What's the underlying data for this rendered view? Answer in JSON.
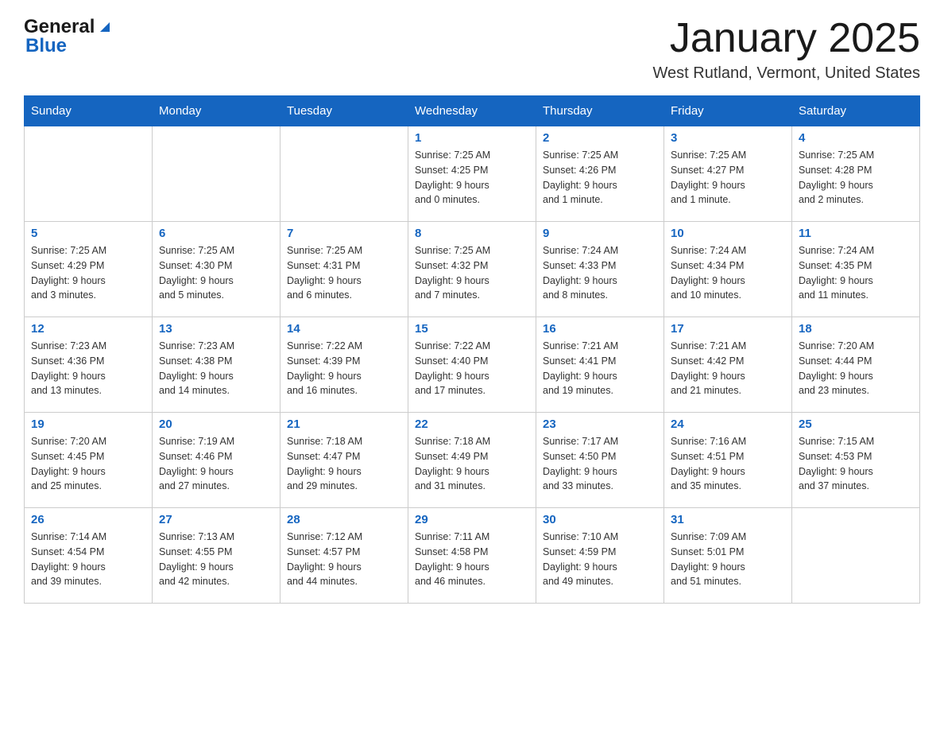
{
  "logo": {
    "general": "General",
    "arrow": "▲",
    "blue": "Blue"
  },
  "header": {
    "title": "January 2025",
    "subtitle": "West Rutland, Vermont, United States"
  },
  "days_of_week": [
    "Sunday",
    "Monday",
    "Tuesday",
    "Wednesday",
    "Thursday",
    "Friday",
    "Saturday"
  ],
  "weeks": [
    [
      {
        "day": "",
        "info": ""
      },
      {
        "day": "",
        "info": ""
      },
      {
        "day": "",
        "info": ""
      },
      {
        "day": "1",
        "info": "Sunrise: 7:25 AM\nSunset: 4:25 PM\nDaylight: 9 hours\nand 0 minutes."
      },
      {
        "day": "2",
        "info": "Sunrise: 7:25 AM\nSunset: 4:26 PM\nDaylight: 9 hours\nand 1 minute."
      },
      {
        "day": "3",
        "info": "Sunrise: 7:25 AM\nSunset: 4:27 PM\nDaylight: 9 hours\nand 1 minute."
      },
      {
        "day": "4",
        "info": "Sunrise: 7:25 AM\nSunset: 4:28 PM\nDaylight: 9 hours\nand 2 minutes."
      }
    ],
    [
      {
        "day": "5",
        "info": "Sunrise: 7:25 AM\nSunset: 4:29 PM\nDaylight: 9 hours\nand 3 minutes."
      },
      {
        "day": "6",
        "info": "Sunrise: 7:25 AM\nSunset: 4:30 PM\nDaylight: 9 hours\nand 5 minutes."
      },
      {
        "day": "7",
        "info": "Sunrise: 7:25 AM\nSunset: 4:31 PM\nDaylight: 9 hours\nand 6 minutes."
      },
      {
        "day": "8",
        "info": "Sunrise: 7:25 AM\nSunset: 4:32 PM\nDaylight: 9 hours\nand 7 minutes."
      },
      {
        "day": "9",
        "info": "Sunrise: 7:24 AM\nSunset: 4:33 PM\nDaylight: 9 hours\nand 8 minutes."
      },
      {
        "day": "10",
        "info": "Sunrise: 7:24 AM\nSunset: 4:34 PM\nDaylight: 9 hours\nand 10 minutes."
      },
      {
        "day": "11",
        "info": "Sunrise: 7:24 AM\nSunset: 4:35 PM\nDaylight: 9 hours\nand 11 minutes."
      }
    ],
    [
      {
        "day": "12",
        "info": "Sunrise: 7:23 AM\nSunset: 4:36 PM\nDaylight: 9 hours\nand 13 minutes."
      },
      {
        "day": "13",
        "info": "Sunrise: 7:23 AM\nSunset: 4:38 PM\nDaylight: 9 hours\nand 14 minutes."
      },
      {
        "day": "14",
        "info": "Sunrise: 7:22 AM\nSunset: 4:39 PM\nDaylight: 9 hours\nand 16 minutes."
      },
      {
        "day": "15",
        "info": "Sunrise: 7:22 AM\nSunset: 4:40 PM\nDaylight: 9 hours\nand 17 minutes."
      },
      {
        "day": "16",
        "info": "Sunrise: 7:21 AM\nSunset: 4:41 PM\nDaylight: 9 hours\nand 19 minutes."
      },
      {
        "day": "17",
        "info": "Sunrise: 7:21 AM\nSunset: 4:42 PM\nDaylight: 9 hours\nand 21 minutes."
      },
      {
        "day": "18",
        "info": "Sunrise: 7:20 AM\nSunset: 4:44 PM\nDaylight: 9 hours\nand 23 minutes."
      }
    ],
    [
      {
        "day": "19",
        "info": "Sunrise: 7:20 AM\nSunset: 4:45 PM\nDaylight: 9 hours\nand 25 minutes."
      },
      {
        "day": "20",
        "info": "Sunrise: 7:19 AM\nSunset: 4:46 PM\nDaylight: 9 hours\nand 27 minutes."
      },
      {
        "day": "21",
        "info": "Sunrise: 7:18 AM\nSunset: 4:47 PM\nDaylight: 9 hours\nand 29 minutes."
      },
      {
        "day": "22",
        "info": "Sunrise: 7:18 AM\nSunset: 4:49 PM\nDaylight: 9 hours\nand 31 minutes."
      },
      {
        "day": "23",
        "info": "Sunrise: 7:17 AM\nSunset: 4:50 PM\nDaylight: 9 hours\nand 33 minutes."
      },
      {
        "day": "24",
        "info": "Sunrise: 7:16 AM\nSunset: 4:51 PM\nDaylight: 9 hours\nand 35 minutes."
      },
      {
        "day": "25",
        "info": "Sunrise: 7:15 AM\nSunset: 4:53 PM\nDaylight: 9 hours\nand 37 minutes."
      }
    ],
    [
      {
        "day": "26",
        "info": "Sunrise: 7:14 AM\nSunset: 4:54 PM\nDaylight: 9 hours\nand 39 minutes."
      },
      {
        "day": "27",
        "info": "Sunrise: 7:13 AM\nSunset: 4:55 PM\nDaylight: 9 hours\nand 42 minutes."
      },
      {
        "day": "28",
        "info": "Sunrise: 7:12 AM\nSunset: 4:57 PM\nDaylight: 9 hours\nand 44 minutes."
      },
      {
        "day": "29",
        "info": "Sunrise: 7:11 AM\nSunset: 4:58 PM\nDaylight: 9 hours\nand 46 minutes."
      },
      {
        "day": "30",
        "info": "Sunrise: 7:10 AM\nSunset: 4:59 PM\nDaylight: 9 hours\nand 49 minutes."
      },
      {
        "day": "31",
        "info": "Sunrise: 7:09 AM\nSunset: 5:01 PM\nDaylight: 9 hours\nand 51 minutes."
      },
      {
        "day": "",
        "info": ""
      }
    ]
  ]
}
